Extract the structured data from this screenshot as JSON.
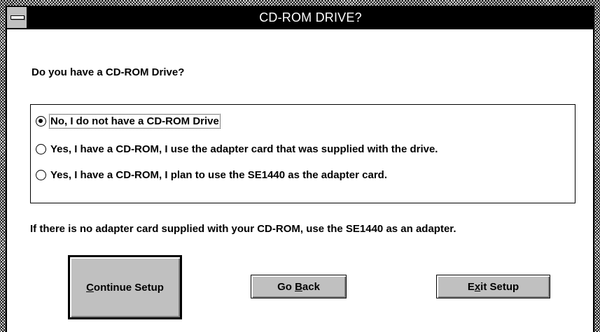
{
  "window": {
    "title": "CD-ROM DRIVE?"
  },
  "prompt": {
    "question": "Do you have a CD-ROM Drive?"
  },
  "options": [
    {
      "label": "No, I do not have a CD-ROM Drive",
      "selected": true
    },
    {
      "label": "Yes, I have a CD-ROM, I use the adapter card that was supplied with the drive.",
      "selected": false
    },
    {
      "label": "Yes, I have a CD-ROM, I plan to use the SE1440 as the adapter card.",
      "selected": false
    }
  ],
  "note": "If there is no adapter card supplied with your CD-ROM, use the SE1440 as an adapter.",
  "buttons": {
    "continue": {
      "mnemonic": "C",
      "rest": "ontinue Setup"
    },
    "back": {
      "pre": "Go ",
      "mnemonic": "B",
      "rest": "ack"
    },
    "exit": {
      "pre": "E",
      "mnemonic": "x",
      "rest": "it Setup"
    }
  },
  "colors": {
    "titlebar": "#000000",
    "title_text": "#ffffff",
    "button_face": "#c0c0c0"
  },
  "icons": {
    "system_menu": "system-menu-icon",
    "radio_selected": "radio-checked-icon",
    "radio_unselected": "radio-unchecked-icon"
  }
}
